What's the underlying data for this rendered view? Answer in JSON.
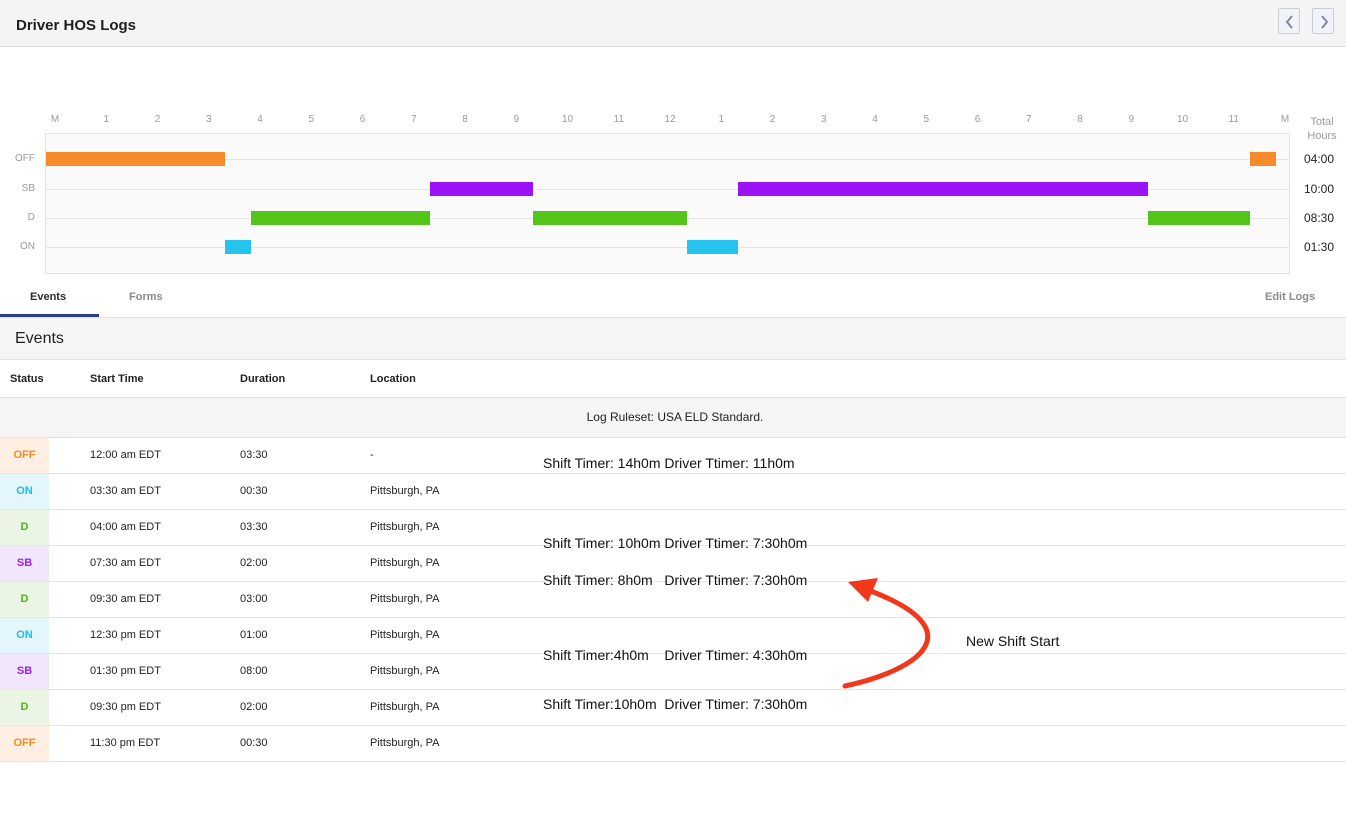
{
  "header": {
    "title": "Driver HOS Logs"
  },
  "chart": {
    "hour_labels": [
      "M",
      "1",
      "2",
      "3",
      "4",
      "5",
      "6",
      "7",
      "8",
      "9",
      "10",
      "11",
      "12",
      "1",
      "2",
      "3",
      "4",
      "5",
      "6",
      "7",
      "8",
      "9",
      "10",
      "11",
      "M"
    ],
    "total_label": "Total Hours",
    "rows": [
      {
        "label": "OFF",
        "total": "04:00",
        "color": "#f68b2b"
      },
      {
        "label": "SB",
        "total": "10:00",
        "color": "#9b12f6"
      },
      {
        "label": "D",
        "total": "08:30",
        "color": "#53c41a"
      },
      {
        "label": "ON",
        "total": "01:30",
        "color": "#27c3ef"
      }
    ],
    "segments": [
      {
        "row": 0,
        "start": 0,
        "end": 3.5
      },
      {
        "row": 3,
        "start": 3.5,
        "end": 4
      },
      {
        "row": 2,
        "start": 4,
        "end": 7.5
      },
      {
        "row": 1,
        "start": 7.5,
        "end": 9.5
      },
      {
        "row": 2,
        "start": 9.5,
        "end": 12.5
      },
      {
        "row": 3,
        "start": 12.5,
        "end": 13.5
      },
      {
        "row": 1,
        "start": 13.5,
        "end": 21.5
      },
      {
        "row": 2,
        "start": 21.5,
        "end": 23.5
      },
      {
        "row": 0,
        "start": 23.5,
        "end": 24
      }
    ]
  },
  "tabs": {
    "events": "Events",
    "forms": "Forms",
    "edit_logs": "Edit Logs"
  },
  "events": {
    "title": "Events",
    "columns": {
      "status": "Status",
      "start_time": "Start Time",
      "duration": "Duration",
      "location": "Location"
    },
    "ruleset": "Log Ruleset: USA ELD Standard.",
    "rows": [
      {
        "status": "OFF",
        "start": "12:00 am EDT",
        "duration": "03:30",
        "location": "-"
      },
      {
        "status": "ON",
        "start": "03:30 am EDT",
        "duration": "00:30",
        "location": "Pittsburgh, PA"
      },
      {
        "status": "D",
        "start": "04:00 am EDT",
        "duration": "03:30",
        "location": "Pittsburgh, PA"
      },
      {
        "status": "SB",
        "start": "07:30 am EDT",
        "duration": "02:00",
        "location": "Pittsburgh, PA"
      },
      {
        "status": "D",
        "start": "09:30 am EDT",
        "duration": "03:00",
        "location": "Pittsburgh, PA"
      },
      {
        "status": "ON",
        "start": "12:30 pm EDT",
        "duration": "01:00",
        "location": "Pittsburgh, PA"
      },
      {
        "status": "SB",
        "start": "01:30 pm EDT",
        "duration": "08:00",
        "location": "Pittsburgh, PA"
      },
      {
        "status": "D",
        "start": "09:30 pm EDT",
        "duration": "02:00",
        "location": "Pittsburgh, PA"
      },
      {
        "status": "OFF",
        "start": "11:30 pm EDT",
        "duration": "00:30",
        "location": "Pittsburgh, PA"
      }
    ]
  },
  "status_styles": {
    "OFF": {
      "color": "#f08a24",
      "bg": "#fdf0e3"
    },
    "ON": {
      "color": "#1cbde8",
      "bg": "#e3f6fc"
    },
    "D": {
      "color": "#4cb81a",
      "bg": "#eaf6e3"
    },
    "SB": {
      "color": "#9a1ff0",
      "bg": "#f2e6fd"
    }
  },
  "annotations": {
    "a1": "Shift Timer: 14h0m Driver Ttimer: 11h0m",
    "a2": "Shift Timer: 10h0m Driver Ttimer: 7:30h0m",
    "a3": "Shift Timer: 8h0m   Driver Ttimer: 7:30h0m",
    "a4": "Shift Timer:4h0m    Driver Ttimer: 4:30h0m",
    "a5": "Shift Timer:10h0m  Driver Ttimer: 7:30h0m",
    "new_shift": "New Shift Start",
    "arrow_color": "#f3371b"
  }
}
